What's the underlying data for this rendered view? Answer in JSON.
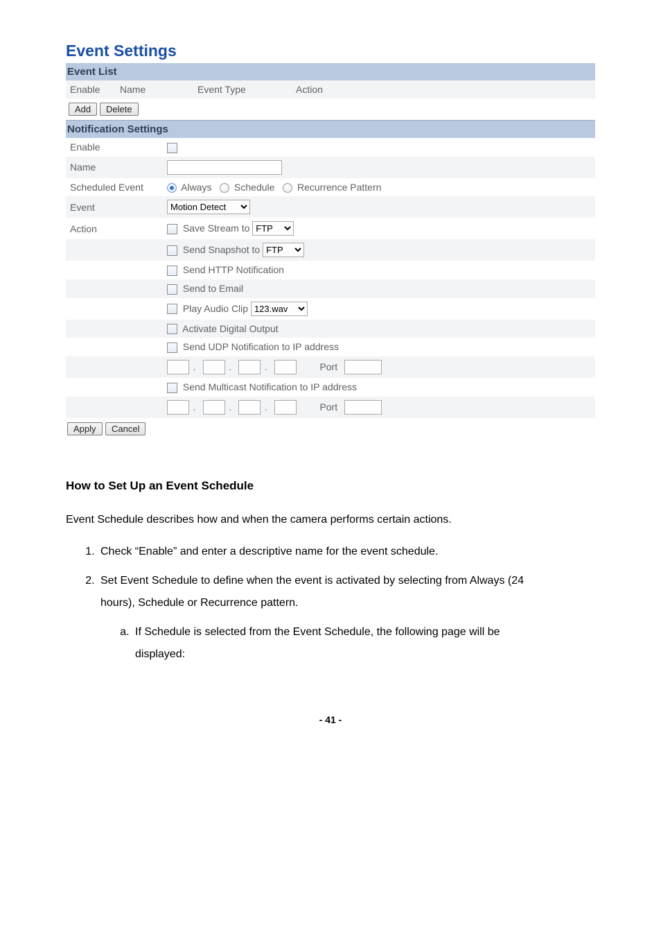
{
  "panel": {
    "title": "Event Settings",
    "event_list_header": "Event List",
    "cols": {
      "enable": "Enable",
      "name": "Name",
      "type": "Event Type",
      "action": "Action"
    },
    "buttons": {
      "add": "Add",
      "delete": "Delete",
      "apply": "Apply",
      "cancel": "Cancel"
    },
    "notif_header": "Notification Settings",
    "rows": {
      "enable": "Enable",
      "name": "Name",
      "sched": "Scheduled Event",
      "event": "Event",
      "action": "Action"
    },
    "sched_opts": {
      "always": "Always",
      "schedule": "Schedule",
      "recur": "Recurrence Pattern"
    },
    "event_select": "Motion Detect",
    "actions": {
      "save_stream": "Save Stream to",
      "save_stream_sel": "FTP",
      "send_snapshot": "Send Snapshot to",
      "send_snapshot_sel": "FTP",
      "http_notif": "Send HTTP Notification",
      "send_email": "Send to Email",
      "play_audio": "Play Audio Clip",
      "play_audio_sel": "123.wav",
      "digital_out": "Activate Digital Output",
      "udp_notif": "Send UDP Notification to IP address",
      "mcast_notif": "Send Multicast Notification to IP address",
      "port": "Port"
    }
  },
  "doc": {
    "heading": "How to Set Up an Event Schedule",
    "intro": "Event Schedule describes how and when the camera performs certain actions.",
    "li1": "Check “Enable” and enter a descriptive name for the event schedule.",
    "li2a": "Set Event Schedule to define when the event is activated by selecting from Always (24",
    "li2b": "hours), Schedule or Recurrence pattern.",
    "li2_a1": "If Schedule is selected from the Event Schedule, the following page will be",
    "li2_a2": "displayed:",
    "page_no": "- 41 -"
  }
}
